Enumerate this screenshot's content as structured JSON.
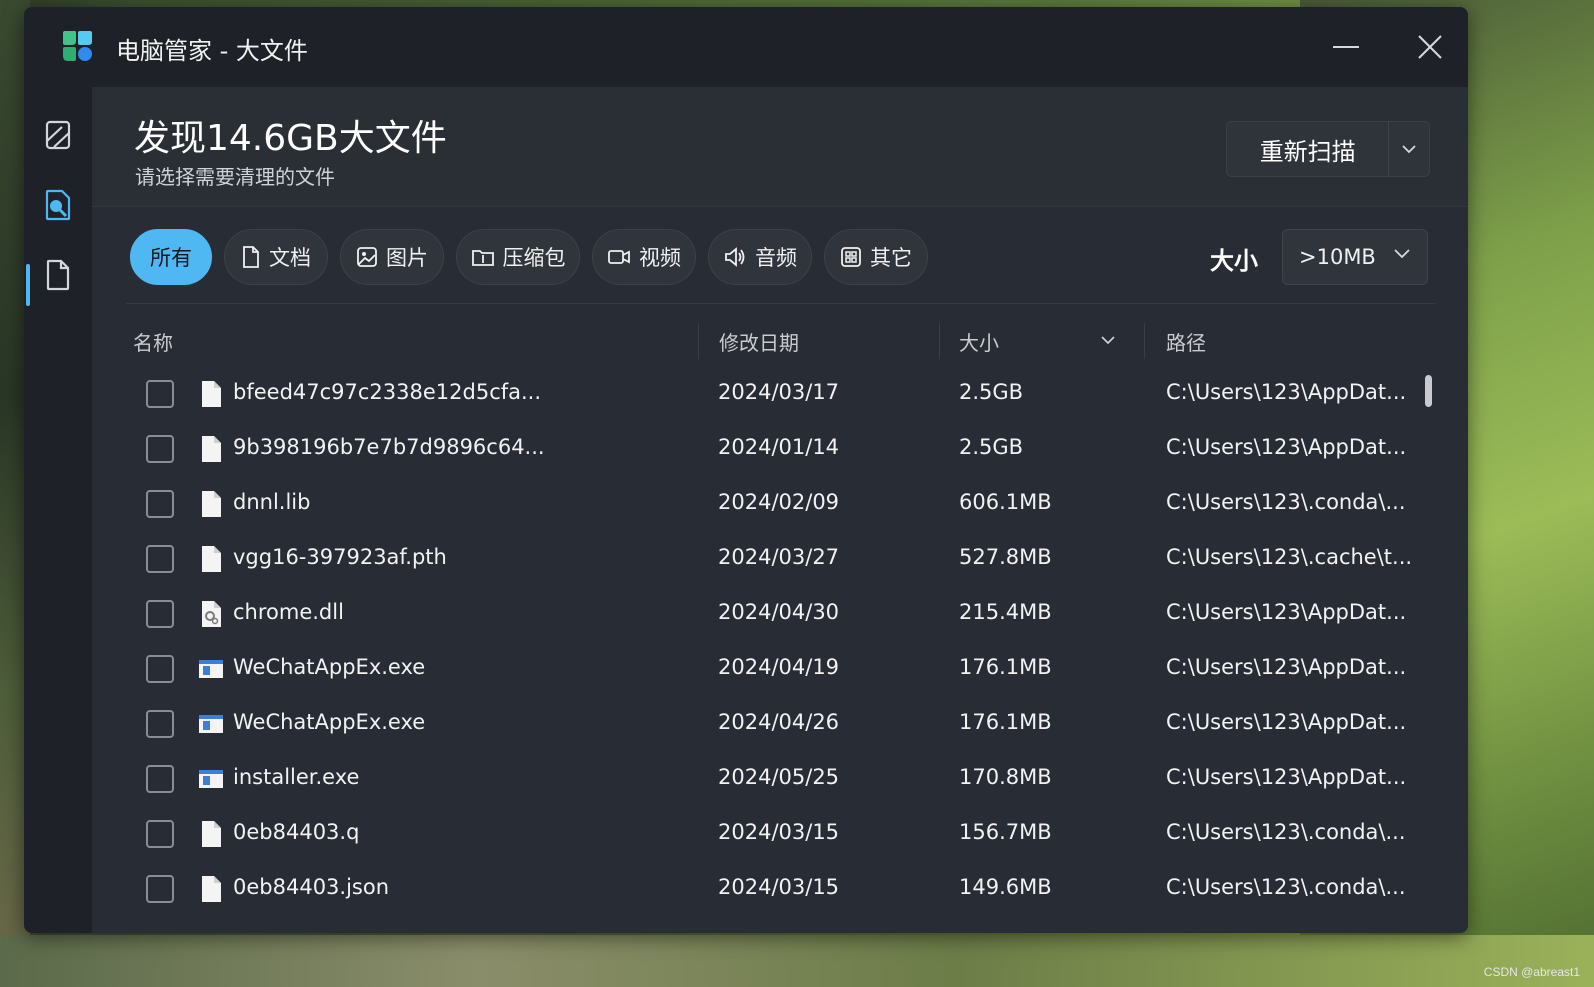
{
  "app": {
    "title": "电脑管家 - 大文件"
  },
  "header": {
    "title": "发现14.6GB大文件",
    "subtitle": "请选择需要清理的文件",
    "rescan_label": "重新扫描"
  },
  "sidebar": {
    "items": [
      {
        "icon": "clean-icon",
        "active": false
      },
      {
        "icon": "file-search-icon",
        "active": true
      },
      {
        "icon": "document-icon",
        "active": false
      }
    ]
  },
  "filters": {
    "chips": [
      {
        "label": "所有",
        "icon": "",
        "active": true
      },
      {
        "label": "文档",
        "icon": "document-icon",
        "active": false
      },
      {
        "label": "图片",
        "icon": "image-icon",
        "active": false
      },
      {
        "label": "压缩包",
        "icon": "archive-icon",
        "active": false
      },
      {
        "label": "视频",
        "icon": "video-icon",
        "active": false
      },
      {
        "label": "音频",
        "icon": "audio-icon",
        "active": false
      },
      {
        "label": "其它",
        "icon": "grid-icon",
        "active": false
      }
    ],
    "size_label": "大小",
    "size_value": ">10MB"
  },
  "table": {
    "columns": {
      "name": "名称",
      "date": "修改日期",
      "size": "大小",
      "path": "路径"
    },
    "rows": [
      {
        "name": "bfeed47c97c2338e12d5cfa...",
        "date": "2024/03/17",
        "size": "2.5GB",
        "path": "C:\\Users\\123\\AppDat...",
        "type": "file"
      },
      {
        "name": "9b398196b7e7b7d9896c64...",
        "date": "2024/01/14",
        "size": "2.5GB",
        "path": "C:\\Users\\123\\AppDat...",
        "type": "file"
      },
      {
        "name": "dnnl.lib",
        "date": "2024/02/09",
        "size": "606.1MB",
        "path": "C:\\Users\\123\\.conda\\...",
        "type": "file"
      },
      {
        "name": "vgg16-397923af.pth",
        "date": "2024/03/27",
        "size": "527.8MB",
        "path": "C:\\Users\\123\\.cache\\t...",
        "type": "file"
      },
      {
        "name": "chrome.dll",
        "date": "2024/04/30",
        "size": "215.4MB",
        "path": "C:\\Users\\123\\AppDat...",
        "type": "dll"
      },
      {
        "name": "WeChatAppEx.exe",
        "date": "2024/04/19",
        "size": "176.1MB",
        "path": "C:\\Users\\123\\AppDat...",
        "type": "exe"
      },
      {
        "name": "WeChatAppEx.exe",
        "date": "2024/04/26",
        "size": "176.1MB",
        "path": "C:\\Users\\123\\AppDat...",
        "type": "exe"
      },
      {
        "name": "installer.exe",
        "date": "2024/05/25",
        "size": "170.8MB",
        "path": "C:\\Users\\123\\AppDat...",
        "type": "exe"
      },
      {
        "name": "0eb84403.q",
        "date": "2024/03/15",
        "size": "156.7MB",
        "path": "C:\\Users\\123\\.conda\\...",
        "type": "file"
      },
      {
        "name": "0eb84403.json",
        "date": "2024/03/15",
        "size": "149.6MB",
        "path": "C:\\Users\\123\\.conda\\...",
        "type": "file"
      }
    ]
  },
  "watermark": "CSDN @abreast1",
  "colors": {
    "accent": "#4fb8f2",
    "window_bg": "#1e2128",
    "panel_bg": "#282c34"
  }
}
